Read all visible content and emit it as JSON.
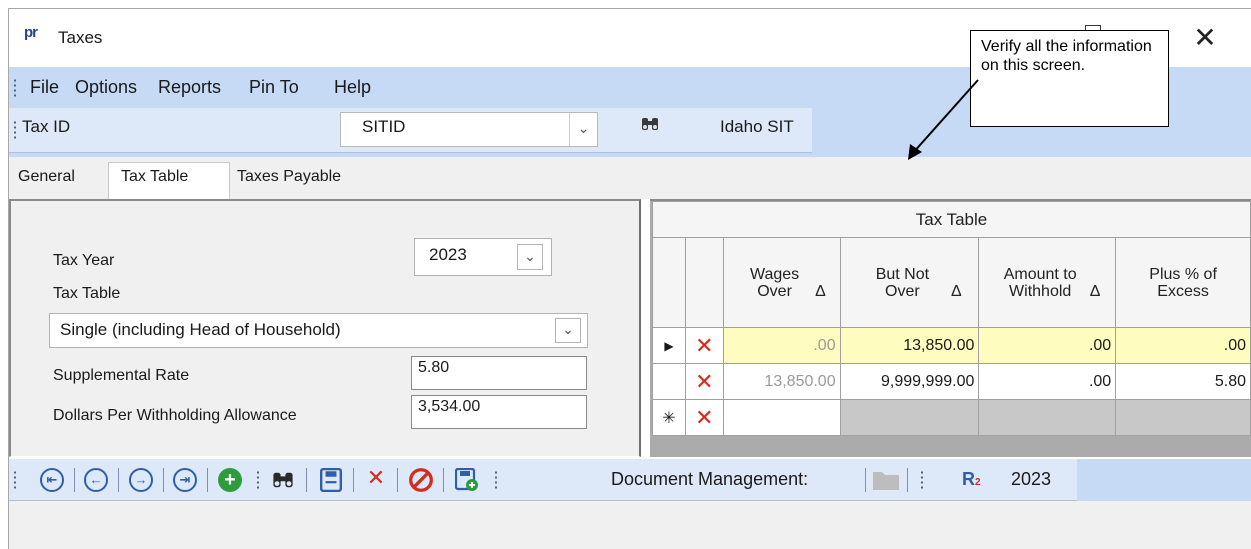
{
  "window": {
    "logo": "pr",
    "title": "Taxes"
  },
  "menu": [
    "File",
    "Options",
    "Reports",
    "Pin To",
    "Help"
  ],
  "taxid": {
    "label": "Tax ID",
    "value": "SITID",
    "name": "Idaho SIT"
  },
  "tabs": [
    "General",
    "Tax Table",
    "Taxes Payable"
  ],
  "form": {
    "tax_year_label": "Tax Year",
    "tax_year": "2023",
    "tax_table_label": "Tax Table",
    "tax_table": "Single (including Head of Household)",
    "supp_rate_label": "Supplemental Rate",
    "supp_rate": "5.80",
    "dollars_label": "Dollars Per Withholding Allowance",
    "dollars": "3,534.00"
  },
  "grid": {
    "title": "Tax Table",
    "headers": [
      "Wages Over",
      "But Not Over",
      "Amount to Withhold",
      "Plus % of Excess"
    ],
    "rows": [
      [
        "",
        "13,850.00",
        ".00",
        ".00"
      ],
      [
        "13,850.00",
        "9,999,999.00",
        ".00",
        "5.80"
      ]
    ],
    "first_cell_row0": ".00"
  },
  "toolbar": {
    "doc_mgmt": "Document Management:",
    "year": "2023"
  },
  "note": "Verify all the information on this screen.",
  "glyphs": {
    "sort": "Δ",
    "row_current": "▶",
    "row_new": "✳",
    "delete": "✕",
    "dropdown": "⌄",
    "close": "✕"
  },
  "colors": {
    "menu_bg": "#c6daf5",
    "toolbar_bg": "#dde9f9",
    "highlight_row": "#fffcc0",
    "delete_red": "#d52a1e"
  }
}
